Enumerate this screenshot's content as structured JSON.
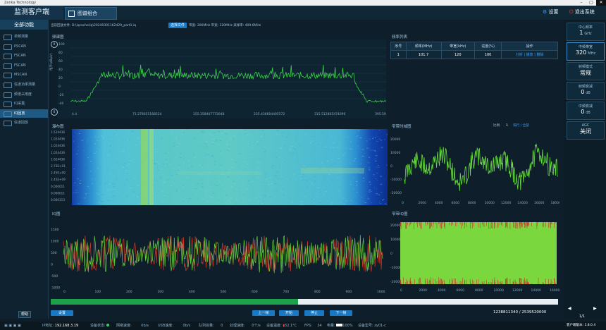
{
  "window": {
    "title": "Zenka Technology"
  },
  "app": {
    "brand": "监测客户端",
    "nav_tab": "图谱组合"
  },
  "header": {
    "settings": "设置",
    "exit": "退出系统"
  },
  "sidebar": {
    "title": "全部功能",
    "items": [
      {
        "label": "单频测量"
      },
      {
        "label": "PSCAN"
      },
      {
        "label": "FSCAN"
      },
      {
        "label": "FSCAN"
      },
      {
        "label": "MSCAN"
      },
      {
        "label": "信道功率测量"
      },
      {
        "label": "频谱占用度"
      },
      {
        "label": "IQ采集"
      },
      {
        "label": "IQ回放"
      },
      {
        "label": "信道回放"
      }
    ],
    "bottom_button": "帮助"
  },
  "file_bar": {
    "label": "当前回放文件:",
    "path": "D:\\iqcache\\iq\\20240301162429_part1.iq",
    "button": "选择文件",
    "info": "带宽: 200MHz 带宽: 120MHz 采样率: 409.6MHz"
  },
  "spectrum": {
    "title": "频谱图",
    "y_label": "电平(dBμV)",
    "y_ticks": [
      "100",
      "80",
      "60",
      "40",
      "20",
      "0",
      "-20",
      "-40"
    ],
    "x_ticks": [
      "4.4",
      "71.278051168524",
      "155.358407773048",
      "235.436604405572",
      "315.512805474096",
      "395.591086484263"
    ]
  },
  "freq_table": {
    "title": "频率列表",
    "headers": [
      "序号",
      "频率(MHz)",
      "带宽(kHz)",
      "进度(%)",
      "操作"
    ],
    "rows": [
      [
        "1",
        "101.7",
        "120",
        "100",
        "分析 | 播放 | 删除"
      ]
    ]
  },
  "waterfall": {
    "title": "瀑布图",
    "y_ticks": [
      "1.524436",
      "1.024436",
      "1.024436",
      "1.024436",
      "1.024436",
      "2.73E+01",
      "2.45E+09",
      "2.45E+09",
      "0.000011",
      "0.000011",
      "0.000113"
    ]
  },
  "narrow_time": {
    "title": "窄带时域图",
    "ratio_label": "比例:",
    "ratio_value": "1",
    "ratio_extra": "隔行 / 全部",
    "y_ticks": [
      "20000",
      "10000",
      "0",
      "-10000",
      "-20000"
    ],
    "x_ticks": [
      "0",
      "2000",
      "4000",
      "6000",
      "8000",
      "10000",
      "12000",
      "14000",
      "16000",
      "18000"
    ]
  },
  "iq": {
    "title": "IQ图",
    "y_ticks": [
      "1500",
      "1000",
      "500",
      "0",
      "-500",
      "-1000"
    ],
    "x_ticks": [
      "0",
      "100",
      "200",
      "300",
      "400",
      "500",
      "600",
      "700",
      "800",
      "900",
      "1000"
    ]
  },
  "narrow_iq": {
    "title": "窄带IQ图",
    "y_ticks": [
      "20000",
      "10000",
      "0",
      "-10000",
      "-20000"
    ],
    "x_ticks": [
      "0",
      "2000",
      "4000",
      "6000",
      "8000",
      "10000",
      "12000",
      "14000",
      "16000"
    ]
  },
  "playback": {
    "left_button": "设置",
    "prev": "上一帧",
    "start": "开始",
    "stop": "停止",
    "next": "下一帧",
    "counter": "1238811340 / 2539520000",
    "progress_percent": 48.8
  },
  "right_panel": [
    {
      "title": "中心频率",
      "value": "1",
      "unit": "GHz"
    },
    {
      "title": "中频带宽",
      "value": "320",
      "unit": "MHz"
    },
    {
      "title": "射频模式",
      "value": "常规",
      "unit": ""
    },
    {
      "title": "射频衰减",
      "value": "0",
      "unit": "dB"
    },
    {
      "title": "中频衰减",
      "value": "0",
      "unit": "dB"
    },
    {
      "title": "AGC",
      "value": "关闭",
      "unit": ""
    }
  ],
  "pager": {
    "text": "1/1",
    "prev": "◀",
    "next": "▶"
  },
  "status_bar": {
    "ip_label": "IP地址:",
    "ip": "192.168.3.19",
    "dev_label": "设备状态:",
    "net_label": "网络速度:",
    "net": "0b/s",
    "usb_label": "USB速度:",
    "usb": "0b/s",
    "queue_label": "队列容量:",
    "queue": "0",
    "proc_label": "处理速度:",
    "proc": "0个/s",
    "temp_label": "设备温度:",
    "temp": "52.1°C",
    "fps_label": "FPS:",
    "fps": "34",
    "power_label": "电量:",
    "power": "100%",
    "model_label": "设备型号:",
    "model": "zy01-c",
    "version": "客户端版本: 1.8.0.4"
  },
  "colors": {
    "accent": "#1a79c4",
    "trace": "#3bd24a",
    "bg": "#0e1f2b"
  }
}
